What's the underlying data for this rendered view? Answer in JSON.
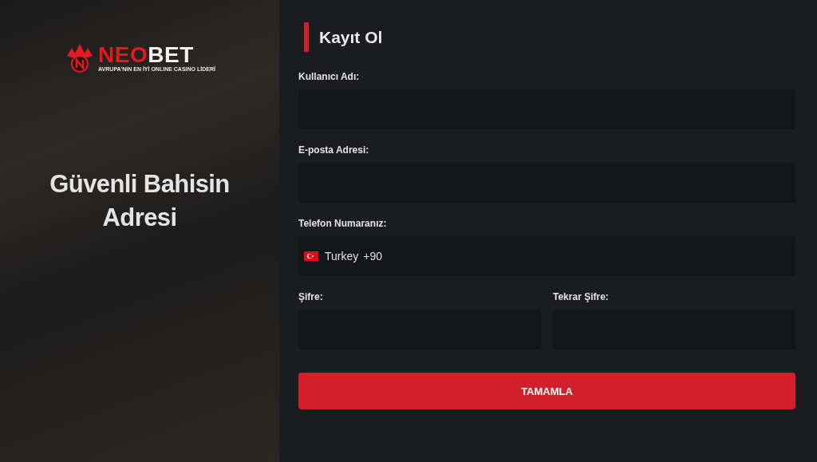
{
  "brand": {
    "name_accent": "NEO",
    "name_rest": "BET",
    "tagline": "AVRUPA'NIN EN İYİ ONLINE CASINO LİDERİ"
  },
  "hero": {
    "headline": "Güvenli Bahisin Adresi"
  },
  "form": {
    "title": "Kayıt Ol",
    "fields": [
      {
        "label": "Kullanıcı Adı:",
        "kind": "text"
      },
      {
        "label": "E-posta Adresi:",
        "kind": "text"
      },
      {
        "label": "Telefon Numaranız:",
        "kind": "phone",
        "country": "Turkey",
        "code": "+90"
      }
    ],
    "password_fields": [
      {
        "label": "Şifre:"
      },
      {
        "label": "Tekrar Şifre:"
      }
    ],
    "submit": "TAMAMLA"
  }
}
